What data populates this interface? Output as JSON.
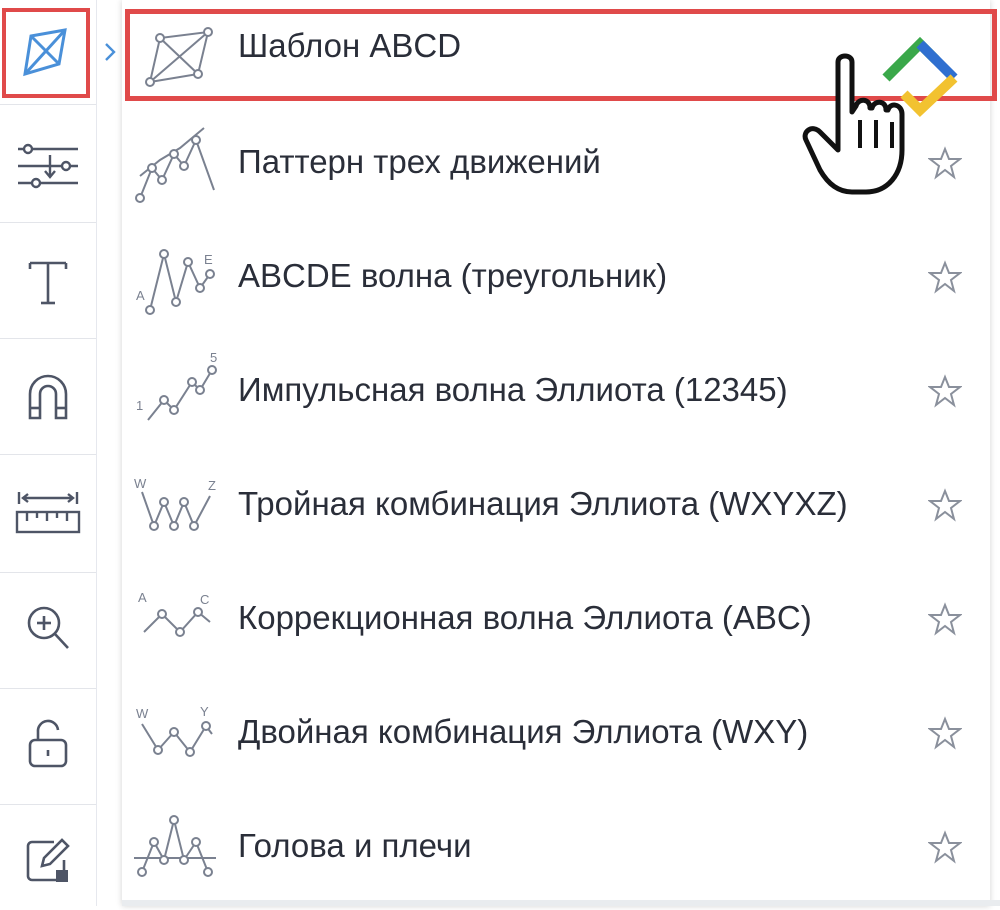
{
  "toolbar": {
    "tools": [
      {
        "name": "pattern-tool",
        "icon": "abcd-pattern-icon",
        "active": true
      },
      {
        "name": "position-tool",
        "icon": "sliders-icon"
      },
      {
        "name": "text-tool",
        "icon": "text-icon"
      },
      {
        "name": "magnet-tool",
        "icon": "magnet-icon"
      },
      {
        "name": "ruler-tool",
        "icon": "ruler-icon"
      },
      {
        "name": "zoom-tool",
        "icon": "zoom-in-icon"
      },
      {
        "name": "lock-tool",
        "icon": "unlock-icon"
      },
      {
        "name": "edit-tool",
        "icon": "edit-icon"
      }
    ],
    "accent": "#4a90d9",
    "icon_color": "#4e5566"
  },
  "menu": {
    "items": [
      {
        "label": "Шаблон ABCD",
        "icon": "abcd-pattern-icon"
      },
      {
        "label": "Паттерн трех движений",
        "icon": "three-drives-icon"
      },
      {
        "label": "ABCDE волна (треугольник)",
        "icon": "abcde-wave-icon"
      },
      {
        "label": "Импульсная волна Эллиота (12345)",
        "icon": "elliott-impulse-icon"
      },
      {
        "label": "Тройная комбинация Эллиота (WXYXZ)",
        "icon": "elliott-triple-combo-icon"
      },
      {
        "label": "Коррекционная волна Эллиота (ABC)",
        "icon": "elliott-correction-icon"
      },
      {
        "label": "Двойная комбинация Эллиота (WXY)",
        "icon": "elliott-double-combo-icon"
      },
      {
        "label": "Голова и плечи",
        "icon": "head-shoulders-icon"
      }
    ],
    "icon_letters": {
      "abcde": [
        "A",
        "E"
      ],
      "impulse": [
        "1",
        "5"
      ],
      "triple": [
        "W",
        "Z"
      ],
      "correction": [
        "A",
        "C"
      ],
      "double": [
        "W",
        "Y"
      ]
    },
    "highlight_color": "#e04a4a",
    "text_color": "#2a2e39"
  }
}
